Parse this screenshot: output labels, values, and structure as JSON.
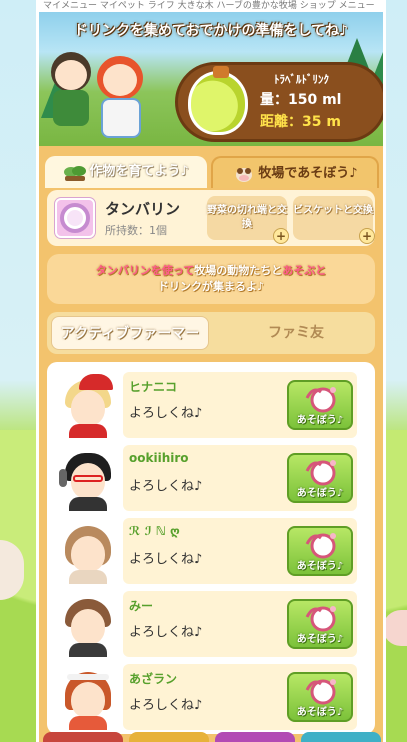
{
  "topbar": {
    "text": "マイメニュー マイペット ライフ 大きな木 ハーブの豊かな牧場 ショップ メニュー"
  },
  "banner": {
    "message": "ドリンクを集めておでかけの準備をしてね♪",
    "travel_title": "ﾄﾗﾍﾞﾙﾄﾞﾘﾝｸ",
    "amount_label": "量：",
    "amount_value": "150 ml",
    "distance_label": "距離：",
    "distance_value": "35 m"
  },
  "tabs": {
    "grow_label": "作物を育てよう♪",
    "play_label": "牧場であそぼう♪"
  },
  "item": {
    "name": "タンバリン",
    "count": "所持数：1個",
    "exchange_vegetable": "野菜の切れ端と交換",
    "exchange_biscuit": "ビスケットと交換",
    "plus": "+"
  },
  "info": {
    "part1": "タンバリンを使って",
    "part2": "牧場の動物たちと",
    "part3": "あそぶと",
    "part4": "ドリンクが集まるよ♪"
  },
  "friend_tabs": {
    "active": "アクティブファーマー",
    "inactive": "ファミ友"
  },
  "friends": [
    {
      "name": "ヒナニコ",
      "message": "よろしくね♪",
      "button": "あそぼう♪"
    },
    {
      "name": "ookiihiro",
      "message": "よろしくね♪",
      "button": "あそぼう♪"
    },
    {
      "name": "ℛ ℐ ℕ ღ",
      "message": "よろしくね♪",
      "button": "あそぼう♪"
    },
    {
      "name": "みー",
      "message": "よろしくね♪",
      "button": "あそぼう♪"
    },
    {
      "name": "あざラン",
      "message": "よろしくね♪",
      "button": "あそぼう♪"
    }
  ],
  "colors": {
    "panel": "#f3c36d",
    "name_green": "#57a02c",
    "accent_pink": "#ff5b8a",
    "button_green": "#7cc23a"
  }
}
